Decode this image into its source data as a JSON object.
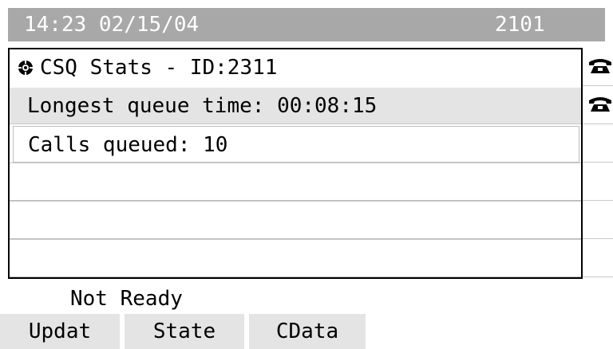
{
  "status_bar": {
    "datetime": "14:23 02/15/04",
    "extension": "2101"
  },
  "panel": {
    "title": "CSQ Stats - ID:2311",
    "title_icon": "gear-icon",
    "rows": [
      {
        "label": "Longest queue time: 00:08:15"
      },
      {
        "label": "Calls queued: 10"
      },
      {
        "label": ""
      },
      {
        "label": ""
      },
      {
        "label": ""
      }
    ]
  },
  "side_lines": {
    "icon": "phone-handset-icon",
    "count_with_icon": 2
  },
  "agent_state": "Not Ready",
  "softkeys": [
    {
      "label": "Updat"
    },
    {
      "label": "State"
    },
    {
      "label": "CData"
    }
  ],
  "colors": {
    "status_bar_bg": "#a8a8a8",
    "status_bar_text": "#ffffff",
    "highlight_row": "#e4e4e4",
    "softkey_bg": "#e4e4e4"
  }
}
